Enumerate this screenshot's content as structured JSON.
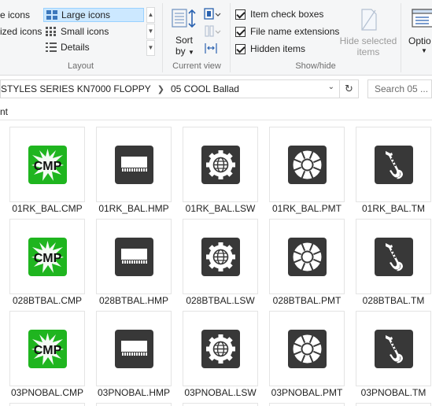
{
  "ribbon": {
    "layout": {
      "group_label": "Layout",
      "options": {
        "extra_large_icons": "e icons",
        "large_icons": "Large icons",
        "medium_icons": "ized icons",
        "small_icons": "Small icons",
        "details": "Details"
      },
      "selected": "Large icons"
    },
    "current_view": {
      "group_label": "Current view",
      "sort_by_label": "Sort",
      "sort_by_sub": "by"
    },
    "show_hide": {
      "group_label": "Show/hide",
      "item_check_boxes": {
        "label": "Item check boxes",
        "checked": true
      },
      "file_name_extensions": {
        "label": "File name extensions",
        "checked": true
      },
      "hidden_items": {
        "label": "Hidden items",
        "checked": true
      },
      "hide_selected_line1": "Hide selected",
      "hide_selected_line2": "items"
    },
    "options_label": "Optio"
  },
  "address": {
    "crumbs": [
      "STYLES SERIES KN7000 FLOPPY",
      "05 COOL Ballad"
    ],
    "search_placeholder": "Search 05 ..."
  },
  "column_header": "nt",
  "files": [
    {
      "name": "01RK_BAL.CMP",
      "icon": "cmp-icon"
    },
    {
      "name": "01RK_BAL.HMP",
      "icon": "keyboard-icon"
    },
    {
      "name": "01RK_BAL.LSW",
      "icon": "globe-gear-icon"
    },
    {
      "name": "01RK_BAL.PMT",
      "icon": "wheel-icon"
    },
    {
      "name": "01RK_BAL.TM",
      "icon": "saxophone-icon"
    },
    {
      "name": "028BTBAL.CMP",
      "icon": "cmp-icon"
    },
    {
      "name": "028BTBAL.HMP",
      "icon": "keyboard-icon"
    },
    {
      "name": "028BTBAL.LSW",
      "icon": "globe-gear-icon"
    },
    {
      "name": "028BTBAL.PMT",
      "icon": "wheel-icon"
    },
    {
      "name": "028BTBAL.TM",
      "icon": "saxophone-icon"
    },
    {
      "name": "03PNOBAL.CMP",
      "icon": "cmp-icon"
    },
    {
      "name": "03PNOBAL.HMP",
      "icon": "keyboard-icon"
    },
    {
      "name": "03PNOBAL.LSW",
      "icon": "globe-gear-icon"
    },
    {
      "name": "03PNOBAL.PMT",
      "icon": "wheel-icon"
    },
    {
      "name": "03PNOBAL.TM",
      "icon": "saxophone-icon"
    }
  ],
  "icon_text": {
    "cmp": "CMP"
  },
  "colors": {
    "cmp_green": "#1fb51f",
    "icon_dark": "#383838",
    "selection_bg": "#cce8ff"
  }
}
